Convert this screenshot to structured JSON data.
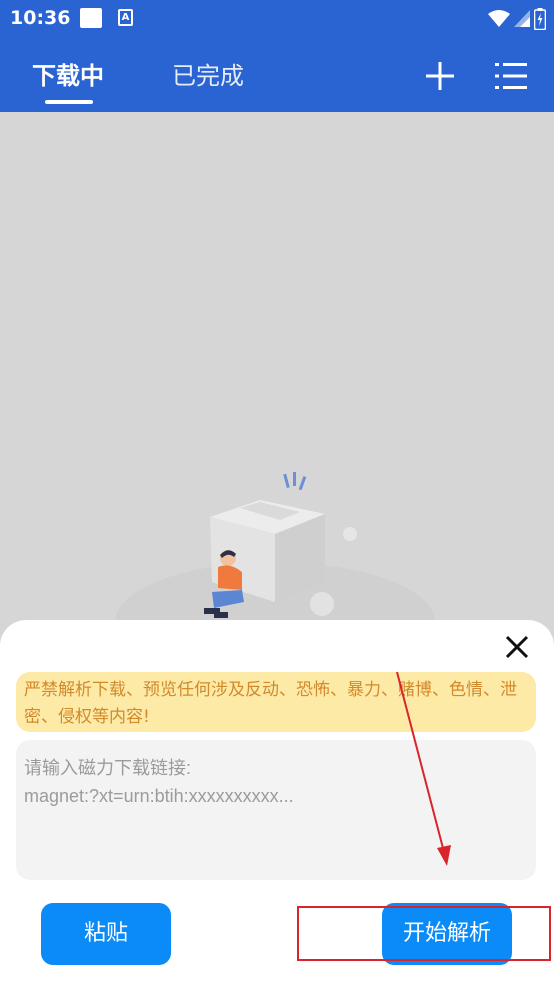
{
  "status_bar": {
    "time": "10:36",
    "notif_app_icon": "A",
    "icons": [
      "wifi-icon",
      "signal-icon",
      "battery-icon"
    ]
  },
  "header": {
    "tabs": [
      {
        "label": "下载中",
        "active": true
      },
      {
        "label": "已完成",
        "active": false
      }
    ],
    "actions": [
      "add-icon",
      "menu-list-icon"
    ]
  },
  "dialog": {
    "warning": "严禁解析下载、预览任何涉及反动、恐怖、暴力、赌博、色情、泄密、侵权等内容!",
    "input_value": "",
    "input_placeholder": "请输入磁力下载链接:\nmagnet:?xt=urn:btih:xxxxxxxxxx...",
    "paste_label": "粘贴",
    "parse_label": "开始解析"
  },
  "colors": {
    "primary": "#2a64d2",
    "button": "#0a8bf8",
    "warning_bg": "#feeaa7",
    "warning_text": "#d18a2c",
    "annotation": "#d9242b"
  }
}
